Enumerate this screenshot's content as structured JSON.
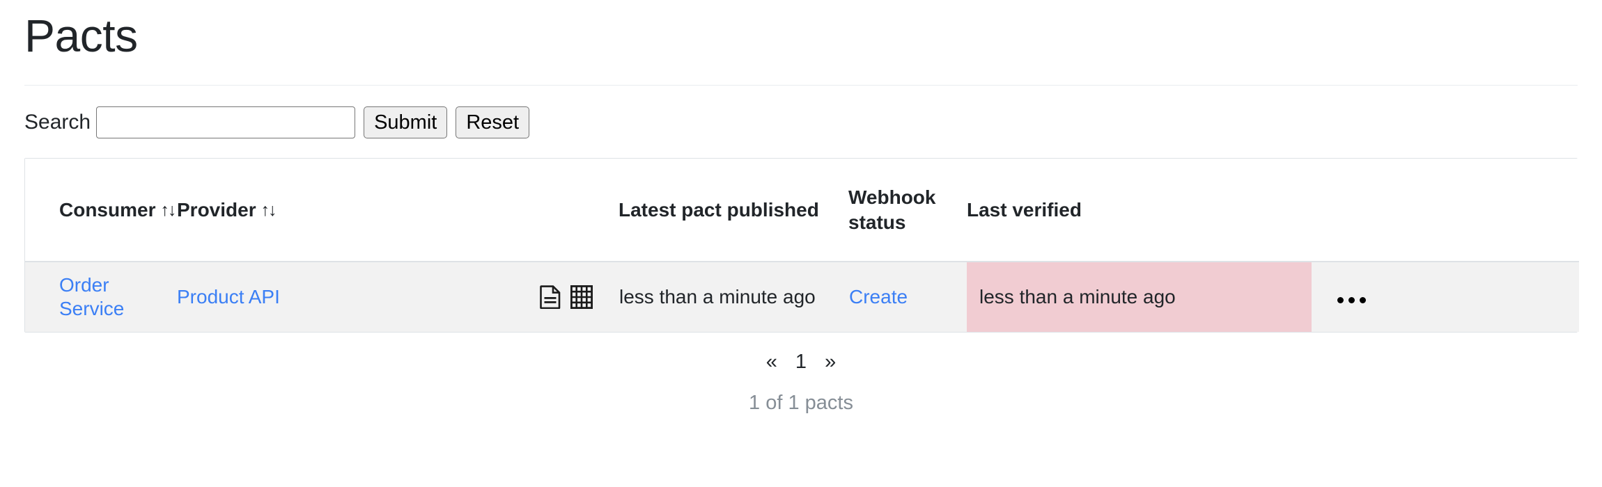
{
  "header": {
    "title": "Pacts"
  },
  "search": {
    "label": "Search",
    "value": "",
    "placeholder": "",
    "submit_label": "Submit",
    "reset_label": "Reset"
  },
  "table": {
    "columns": [
      {
        "key": "consumer",
        "label": "Consumer",
        "sortable": true,
        "sort_icon": "↑↓"
      },
      {
        "key": "provider",
        "label": "Provider",
        "sortable": true,
        "sort_icon": "↑↓"
      },
      {
        "key": "artifacts",
        "label": "",
        "sortable": false
      },
      {
        "key": "latest_pact_published",
        "label": "Latest pact published",
        "sortable": false
      },
      {
        "key": "webhook_status",
        "label": "Webhook status",
        "sortable": false
      },
      {
        "key": "last_verified",
        "label": "Last verified",
        "sortable": false
      },
      {
        "key": "actions",
        "label": "",
        "sortable": false
      }
    ],
    "rows": [
      {
        "consumer": "Order Service",
        "provider": "Product API",
        "artifact_icons": [
          {
            "name": "pact-document-icon",
            "title": "document"
          },
          {
            "name": "matrix-grid-icon",
            "title": "matrix"
          }
        ],
        "latest_pact_published": "less than a minute ago",
        "webhook_status": "Create",
        "last_verified": "less than a minute ago",
        "last_verified_state": "failed",
        "actions_label": "•••"
      }
    ]
  },
  "pagination": {
    "first_label": "«",
    "last_label": "»",
    "current_page": "1",
    "result_count": "1 of 1 pacts"
  },
  "colors": {
    "link": "#3b7ff5",
    "failed_background": "#f1ccd2",
    "row_background": "#f2f2f2",
    "table_border": "#dee2e6",
    "muted_text": "#868e96"
  }
}
